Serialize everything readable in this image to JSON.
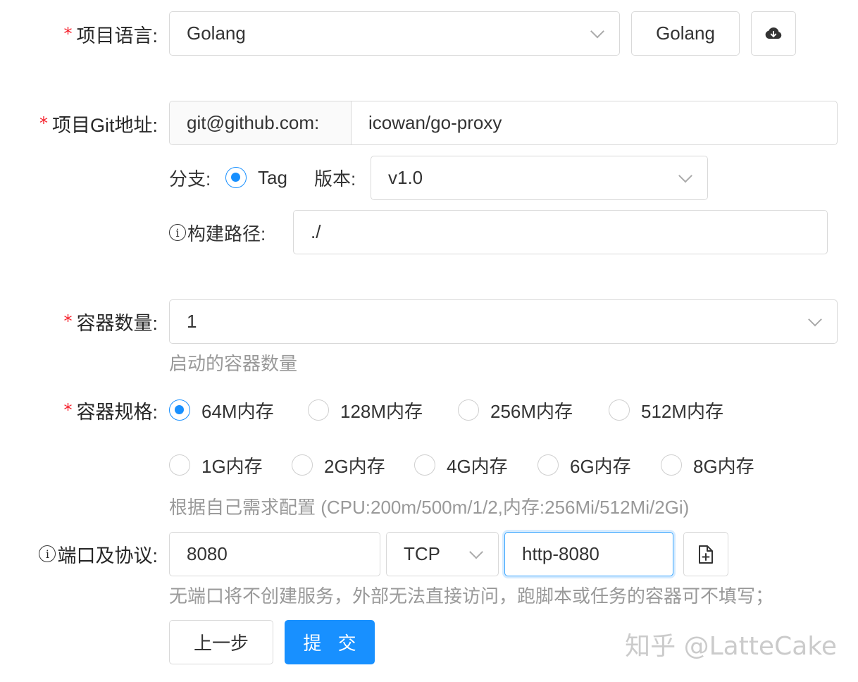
{
  "language": {
    "label": "项目语言:",
    "selected": "Golang",
    "button": "Golang",
    "icon": "cloud-download-icon"
  },
  "git": {
    "label": "项目Git地址:",
    "prefix": "git@github.com:",
    "value": "icowan/go-proxy",
    "branch_label": "分支:",
    "branch_option": "Tag",
    "version_label": "版本:",
    "version_value": "v1.0",
    "build_path_label": "构建路径:",
    "build_path_value": "./"
  },
  "containers": {
    "label": "容器数量:",
    "value": "1",
    "hint": "启动的容器数量"
  },
  "spec": {
    "label": "容器规格:",
    "options": [
      "64M内存",
      "128M内存",
      "256M内存",
      "512M内存",
      "1G内存",
      "2G内存",
      "4G内存",
      "6G内存",
      "8G内存"
    ],
    "selected_index": 0,
    "hint": "根据自己需求配置 (CPU:200m/500m/1/2,内存:256Mi/512Mi/2Gi)"
  },
  "port": {
    "label": "端口及协议:",
    "port_value": "8080",
    "protocol": "TCP",
    "name_value": "http-8080",
    "hint": "无端口将不创建服务，外部无法直接访问，跑脚本或任务的容器可不填写；",
    "icon": "file-add-icon"
  },
  "actions": {
    "prev": "上一步",
    "submit": "提 交"
  },
  "watermark": "知乎 @LatteCake",
  "colors": {
    "primary": "#1890ff",
    "required": "#f5222d",
    "border": "#d9d9d9",
    "hint": "#999999"
  }
}
